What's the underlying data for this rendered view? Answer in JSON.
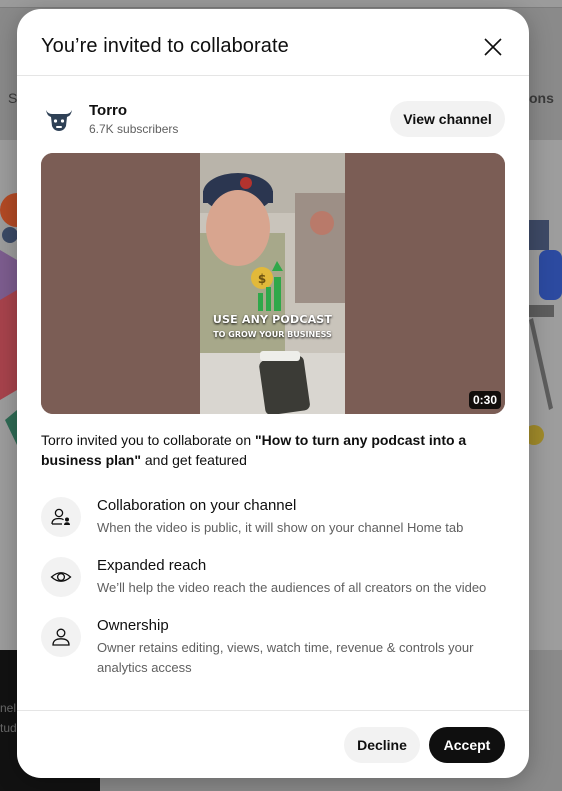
{
  "background": {
    "left_fragment": "S",
    "right_fragment": "ons",
    "dark_fragment_1": "nel",
    "dark_fragment_2": "tud"
  },
  "dialog": {
    "title": "You’re invited to collaborate",
    "close_icon": "close-icon"
  },
  "channel": {
    "name": "Torro",
    "subscribers": "6.7K subscribers",
    "avatar_icon": "bull-logo-icon",
    "view_button": "View channel"
  },
  "video": {
    "caption_line_1": "USE ANY PODCAST",
    "caption_line_2": "TO GROW YOUR BUSINESS",
    "duration": "0:30"
  },
  "invite": {
    "prefix": "Torro invited you to collaborate on ",
    "video_title": "\"How to turn any podcast into a business plan\"",
    "suffix": " and get featured"
  },
  "features": [
    {
      "icon": "person-share-icon",
      "title": "Collaboration on your channel",
      "description": "When the video is public, it will show on your channel Home tab"
    },
    {
      "icon": "eye-icon",
      "title": "Expanded reach",
      "description": "We’ll help the video reach the audiences of all creators on the video"
    },
    {
      "icon": "person-icon",
      "title": "Ownership",
      "description": "Owner retains editing, views, watch time, revenue & controls your analytics access"
    }
  ],
  "footer": {
    "decline": "Decline",
    "accept": "Accept"
  },
  "colors": {
    "accent_dark": "#0f0f0f",
    "button_gray": "#f2f2f2",
    "secondary_text": "#606060"
  }
}
